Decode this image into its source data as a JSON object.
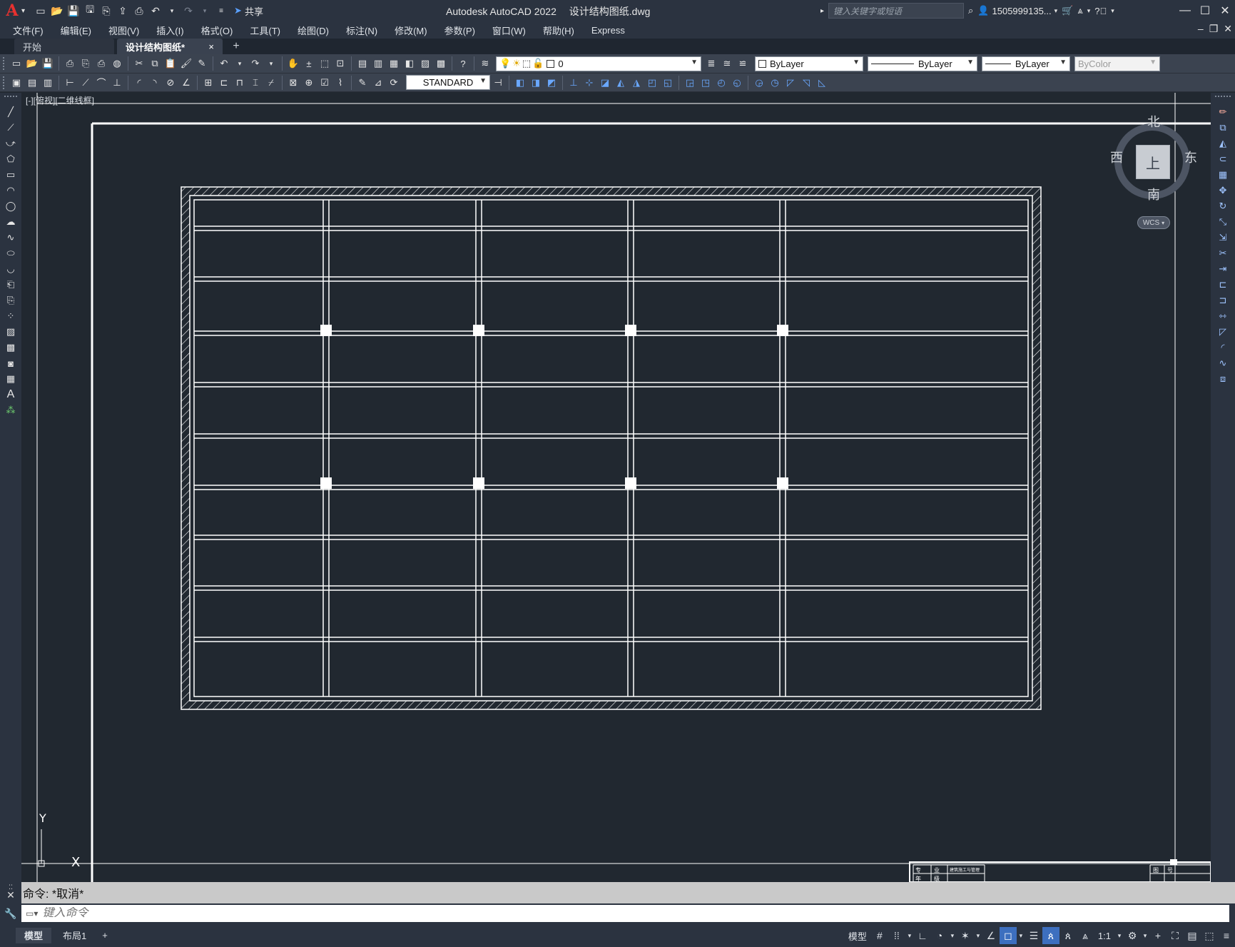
{
  "app": {
    "logo": "A",
    "title_app": "Autodesk AutoCAD 2022",
    "title_file": "设计结构图纸.dwg",
    "share_label": "共享",
    "search_placeholder": "键入关键字或短语",
    "user_name": "1505999135..."
  },
  "menu": [
    "文件(F)",
    "编辑(E)",
    "视图(V)",
    "插入(I)",
    "格式(O)",
    "工具(T)",
    "绘图(D)",
    "标注(N)",
    "修改(M)",
    "参数(P)",
    "窗口(W)",
    "帮助(H)",
    "Express"
  ],
  "tabs": {
    "start": "开始",
    "active": "设计结构图纸*",
    "close": "×",
    "add": "+"
  },
  "toolbar": {
    "layer_value": "0",
    "color_value": "ByLayer",
    "linetype_value": "ByLayer",
    "lineweight_value": "ByLayer",
    "plotstyle_value": "ByColor",
    "textstyle_value": "STANDARD"
  },
  "viewport": {
    "label": "[-][俯视][二维线框]"
  },
  "viewcube": {
    "north": "北",
    "south": "南",
    "east": "东",
    "west": "西",
    "face": "上",
    "wcs": "WCS"
  },
  "ucs": {
    "y_label": "Y",
    "x_label": "X"
  },
  "titleblock": {
    "c1": "专",
    "c2": "业",
    "c3": "建筑施工与管理",
    "c4": "年",
    "c5": "级",
    "c6": "图",
    "c7": "号"
  },
  "command": {
    "history": "命令: *取消*",
    "placeholder": "键入命令"
  },
  "status": {
    "model_tab": "模型",
    "layout_tab": "布局1",
    "add_tab": "+",
    "model_label": "模型",
    "scale_label": "1:1"
  },
  "colors": {
    "accent": "#3d6fbf",
    "drawing_bg": "#212830",
    "autocad_red": "#e8312f"
  }
}
